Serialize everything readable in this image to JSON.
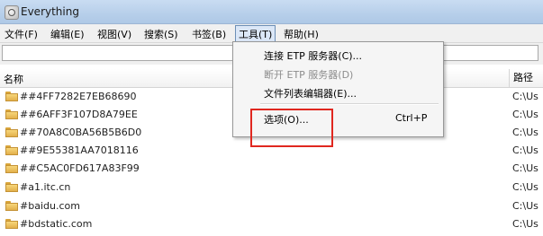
{
  "window": {
    "title": "Everything"
  },
  "menubar": {
    "items": [
      {
        "label": "文件(F)"
      },
      {
        "label": "编辑(E)"
      },
      {
        "label": "视图(V)"
      },
      {
        "label": "搜索(S)"
      },
      {
        "label": "书签(B)"
      },
      {
        "label": "工具(T)"
      },
      {
        "label": "帮助(H)"
      }
    ]
  },
  "search": {
    "value": ""
  },
  "columns": {
    "name": "名称",
    "path": "路径"
  },
  "rows": [
    {
      "name": "##4FF7282E7EB68690",
      "path": "C:\\Us"
    },
    {
      "name": "##6AFF3F107D8A79EE",
      "path": "C:\\Us"
    },
    {
      "name": "##70A8C0BA56B5B6D0",
      "path": "C:\\Us"
    },
    {
      "name": "##9E55381AA7018116",
      "path": "C:\\Us"
    },
    {
      "name": "##C5AC0FD617A83F99",
      "path": "C:\\Us"
    },
    {
      "name": "#a1.itc.cn",
      "path": "C:\\Us"
    },
    {
      "name": "#baidu.com",
      "path": "C:\\Us"
    },
    {
      "name": "#bdstatic.com",
      "path": "C:\\Us"
    }
  ],
  "tools_menu": {
    "items": [
      {
        "label": "连接 ETP 服务器(C)...",
        "enabled": true
      },
      {
        "label": "断开 ETP 服务器(D)",
        "enabled": false
      },
      {
        "label": "文件列表编辑器(E)...",
        "enabled": true
      },
      {
        "label": "选项(O)...",
        "shortcut": "Ctrl+P",
        "enabled": true
      }
    ]
  },
  "colors": {
    "highlight_box": "#e0271f",
    "menu_active_bg": "#dbe7f7"
  },
  "icons": {
    "app": "everything-search-icon",
    "folder": "folder-icon"
  }
}
